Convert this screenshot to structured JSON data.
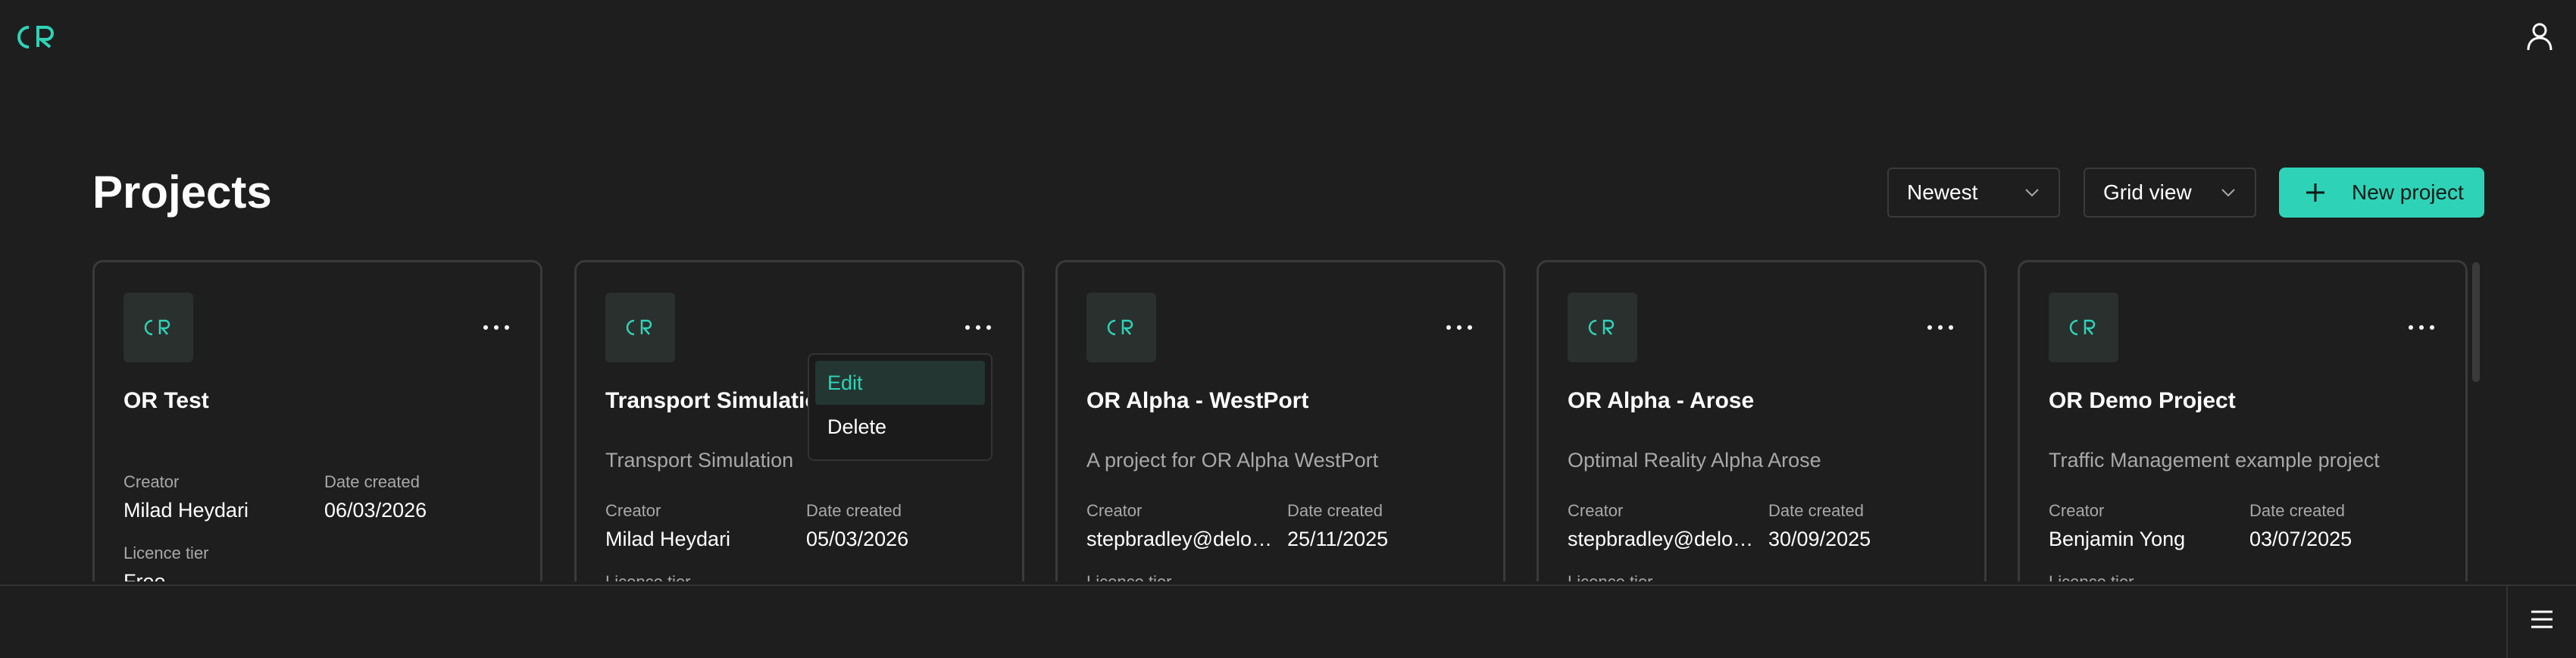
{
  "header": {
    "logo_text": "OR",
    "user_icon": "user-icon"
  },
  "page": {
    "title": "Projects"
  },
  "toolbar": {
    "sort_label": "Newest",
    "view_label": "Grid view",
    "new_project_label": "New project"
  },
  "labels": {
    "creator": "Creator",
    "date_created": "Date created",
    "licence_tier": "Licence tier"
  },
  "projects": [
    {
      "title": "OR Test",
      "description": "",
      "creator": "Milad Heydari",
      "date": "06/03/2026",
      "tier": "Free"
    },
    {
      "title": "Transport Simulation",
      "description": "Transport Simulation",
      "creator": "Milad Heydari",
      "date": "05/03/2026",
      "tier": ""
    },
    {
      "title": "OR Alpha - WestPort",
      "description": "A project for OR Alpha WestPort",
      "creator": "stepbradley@deloitte.com.au",
      "date": "25/11/2025",
      "tier": ""
    },
    {
      "title": "OR Alpha - Arose",
      "description": "Optimal Reality Alpha Arose",
      "creator": "stepbradley@deloitte.com.au",
      "date": "30/09/2025",
      "tier": ""
    },
    {
      "title": "OR Demo Project",
      "description": "Traffic Management example project",
      "creator": "Benjamin Yong",
      "date": "03/07/2025",
      "tier": ""
    }
  ],
  "context_menu": {
    "edit_label": "Edit",
    "delete_label": "Delete"
  },
  "colors": {
    "accent": "#2ed3b7",
    "background": "#1e1e1e",
    "card_border": "#3a3a3a"
  }
}
